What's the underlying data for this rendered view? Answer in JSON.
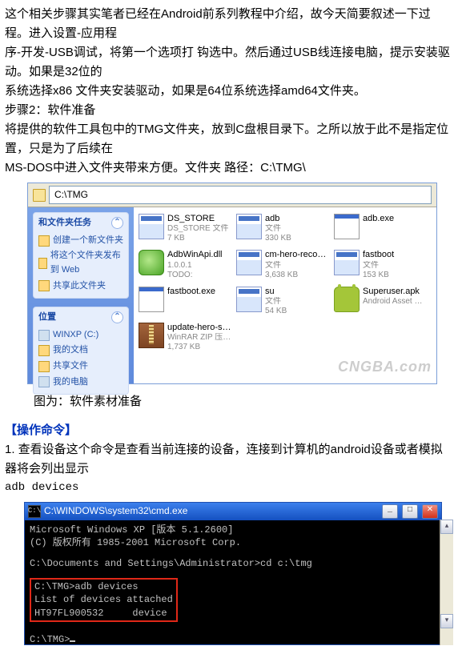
{
  "intro": {
    "p1": "这个相关步骤其实笔者已经在Android前系列教程中介绍，故今天简要叙述一下过程。进入设置-应用程",
    "p2": "序-开发-USB调试，将第一个选项打 钩选中。然后通过USB线连接电脑，提示安装驱动。如果是32位的",
    "p3": "系统选择x86 文件夹安装驱动，如果是64位系统选择amd64文件夹。",
    "step2": "步骤2：软件准备",
    "p4": "将提供的软件工具包中的TMG文件夹，放到C盘根目录下。之所以放于此不是指定位置，只是为了后续在",
    "p5": "MS-DOS中进入文件夹带来方便。文件夹 路径：C:\\TMG\\"
  },
  "explorer": {
    "address": "C:\\TMG",
    "side_tasks_title": "和文件夹任务",
    "tasks": {
      "new": "创建一个新文件夹",
      "pub": "将这个文件夹发布到 Web",
      "share": "共享此文件夹"
    },
    "side_places_title": "位置",
    "places": {
      "c": "WINXP (C:)",
      "docs": "我的文档",
      "shared": "共享文件",
      "mypc": "我的电脑"
    },
    "files": [
      {
        "name": "DS_STORE",
        "type": "DS_STORE 文件",
        "size": "7 KB",
        "cls": "cal"
      },
      {
        "name": "adb",
        "type": "文件",
        "size": "330 KB",
        "cls": "cal"
      },
      {
        "name": "adb.exe",
        "type": "",
        "size": "",
        "cls": "exe"
      },
      {
        "name": "AdbWinApi.dll",
        "type": "1.0.0.1",
        "size": "TODO: <File desc...",
        "cls": "dll"
      },
      {
        "name": "cm-hero-recovery...",
        "type": "文件",
        "size": "3,638 KB",
        "cls": "cal"
      },
      {
        "name": "fastboot",
        "type": "文件",
        "size": "153 KB",
        "cls": "cal"
      },
      {
        "name": "fastboot.exe",
        "type": "",
        "size": "",
        "cls": "exe"
      },
      {
        "name": "su",
        "type": "文件",
        "size": "54 KB",
        "cls": "cal"
      },
      {
        "name": "Superuser.apk",
        "type": "Android Asset Pa...",
        "size": "",
        "cls": "apk"
      },
      {
        "name": "update-hero-sign",
        "type": "WinRAR ZIP 压缩文件",
        "size": "1,737 KB",
        "cls": "zip"
      }
    ],
    "watermark": "CNGBA.com"
  },
  "caption1": "图为：软件素材准备",
  "section_cmds": "【操作命令】",
  "cmds": {
    "p1": "1. 查看设备这个命令是查看当前连接的设备，连接到计算机的android设备或者模拟器将会列出显示",
    "cmd": "adb devices"
  },
  "cmd_win": {
    "title": "C:\\WINDOWS\\system32\\cmd.exe",
    "l1": "Microsoft Windows XP [版本 5.1.2600]",
    "l2": "(C) 版权所有 1985-2001 Microsoft Corp.",
    "l3": "C:\\Documents and Settings\\Administrator>cd c:\\tmg",
    "r1": "C:\\TMG>adb devices",
    "r2": "List of devices attached",
    "r3": "HT97FL900532     device",
    "l4": "C:\\TMG>"
  }
}
